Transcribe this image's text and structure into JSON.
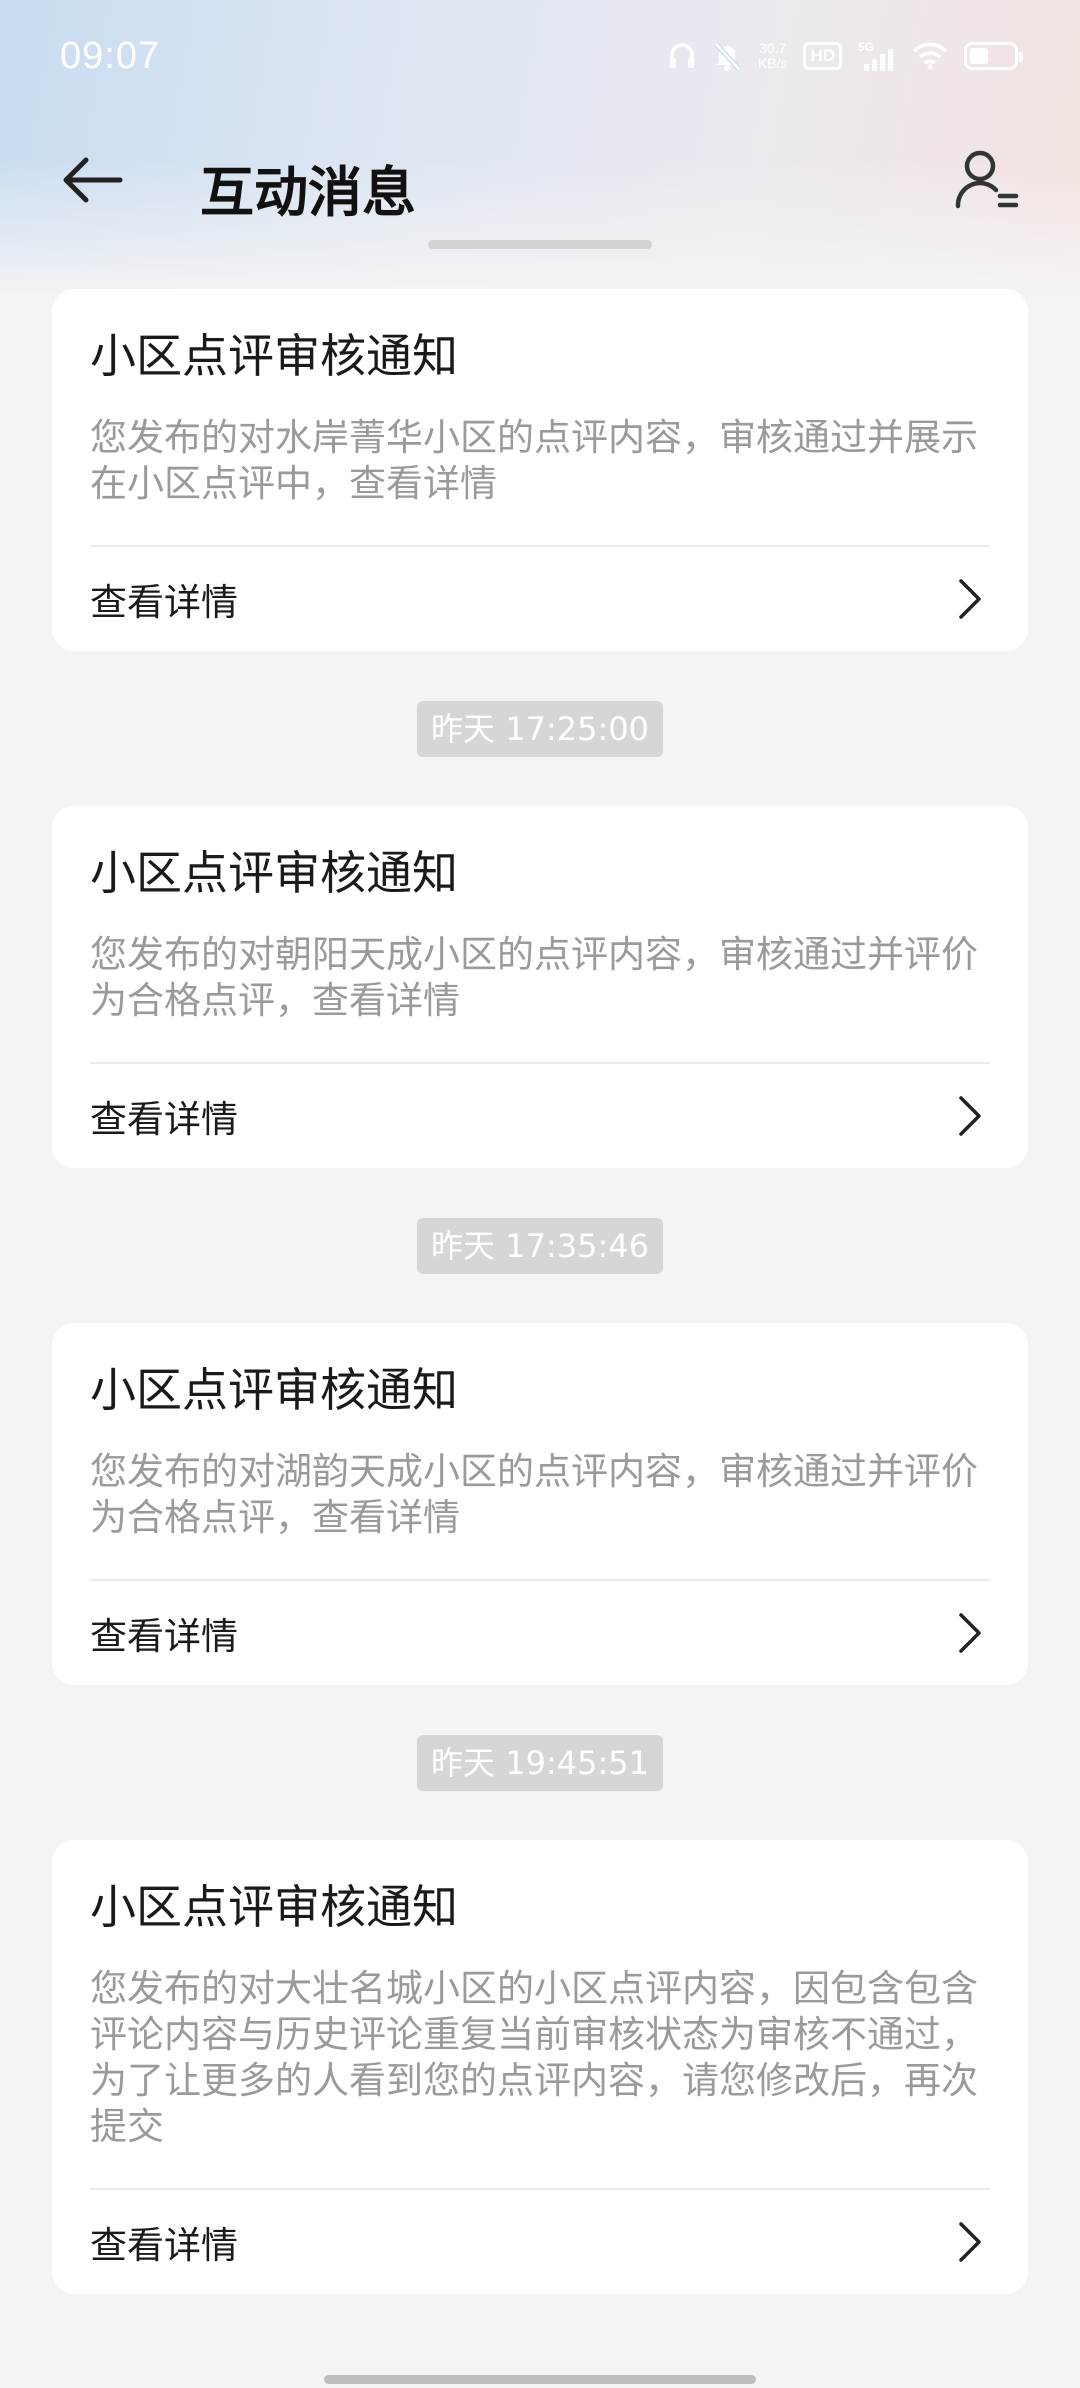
{
  "status_bar": {
    "time": "09:07",
    "net_speed_value": "30.7",
    "net_speed_unit": "KB/s",
    "hd_label": "HD",
    "network_label": "5G",
    "icons": [
      "headphones-icon",
      "mute-bell-icon",
      "signal-icon",
      "wifi-icon",
      "battery-icon"
    ]
  },
  "nav": {
    "title": "互动消息",
    "back_icon": "arrow-left-icon",
    "profile_icon": "user-list-icon"
  },
  "messages": [
    {
      "title": "小区点评审核通知",
      "desc": "您发布的对水岸菁华小区的点评内容，审核通过并展示在小区点评中，查看详情",
      "action": "查看详情"
    },
    {
      "timestamp": "昨天 17:25:00",
      "title": "小区点评审核通知",
      "desc": "您发布的对朝阳天成小区的点评内容，审核通过并评价为合格点评，查看详情",
      "action": "查看详情"
    },
    {
      "timestamp": "昨天 17:35:46",
      "title": "小区点评审核通知",
      "desc": "您发布的对湖韵天成小区的点评内容，审核通过并评价为合格点评，查看详情",
      "action": "查看详情"
    },
    {
      "timestamp": "昨天 19:45:51",
      "title": "小区点评审核通知",
      "desc": "您发布的对大壮名城小区的小区点评内容，因包含包含评论内容与历史评论重复当前审核状态为审核不通过，为了让更多的人看到您的点评内容，请您修改后，再次提交",
      "action": "查看详情"
    }
  ]
}
